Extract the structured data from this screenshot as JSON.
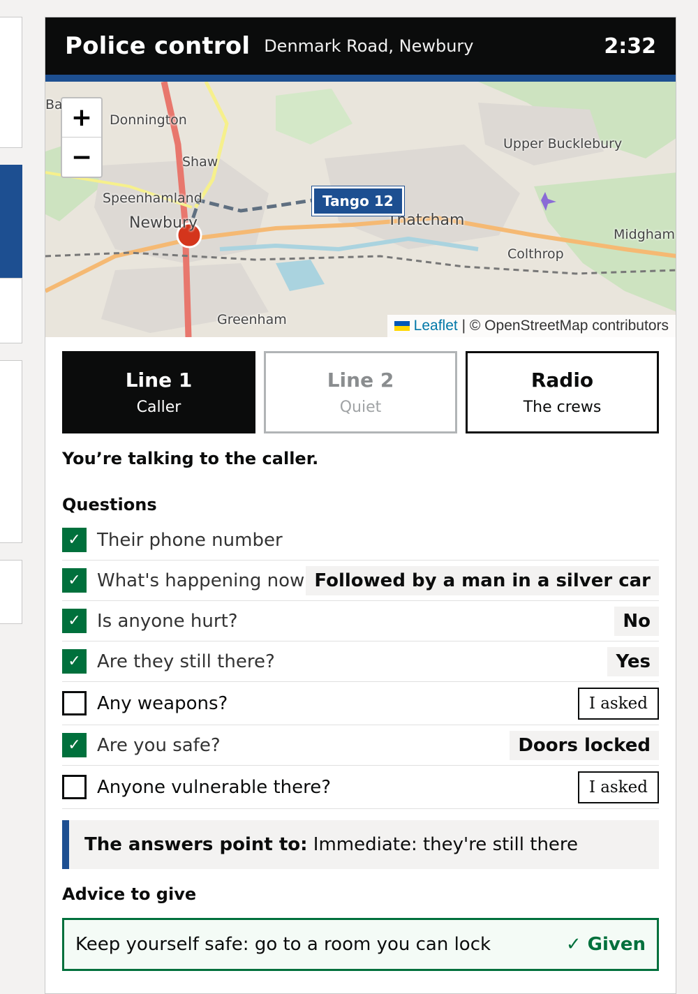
{
  "header": {
    "title": "Police control",
    "location": "Denmark Road, Newbury",
    "timer": "2:32"
  },
  "map": {
    "zoom_in": "+",
    "zoom_out": "−",
    "unit_label": "Tango 12",
    "places": [
      "Donnington",
      "Shaw",
      "Speenhamland",
      "Newbury",
      "Thatcham",
      "Upper Bucklebury",
      "Midgham",
      "Colthrop",
      "Greenham",
      "Ba"
    ],
    "attribution_link": "Leaflet",
    "attribution_sep": "|",
    "attribution_text": "© OpenStreetMap contributors"
  },
  "lines": [
    {
      "name": "Line 1",
      "sub": "Caller"
    },
    {
      "name": "Line 2",
      "sub": "Quiet"
    },
    {
      "name": "Radio",
      "sub": "The crews"
    }
  ],
  "status": "You’re talking to the caller.",
  "questions": {
    "heading": "Questions",
    "items": [
      {
        "text": "Their phone number",
        "checked": true,
        "answer": ""
      },
      {
        "text": "What's happening now",
        "checked": true,
        "answer": "Followed by a man in a silver car"
      },
      {
        "text": "Is anyone hurt?",
        "checked": true,
        "answer": "No"
      },
      {
        "text": "Are they still there?",
        "checked": true,
        "answer": "Yes"
      },
      {
        "text": "Any weapons?",
        "checked": false,
        "button": "I asked"
      },
      {
        "text": "Are you safe?",
        "checked": true,
        "answer": "Doors locked"
      },
      {
        "text": "Anyone vulnerable there?",
        "checked": false,
        "button": "I asked"
      }
    ],
    "check_mark": "✓"
  },
  "inset": {
    "label": "The answers point to:",
    "value": "Immediate: they're still there"
  },
  "advice": {
    "heading": "Advice to give",
    "text": "Keep yourself safe: go to a room you can lock",
    "status": "✓ Given"
  },
  "colors": {
    "brand_blue": "#1d4f91",
    "green": "#00703c",
    "black": "#0b0c0c"
  }
}
